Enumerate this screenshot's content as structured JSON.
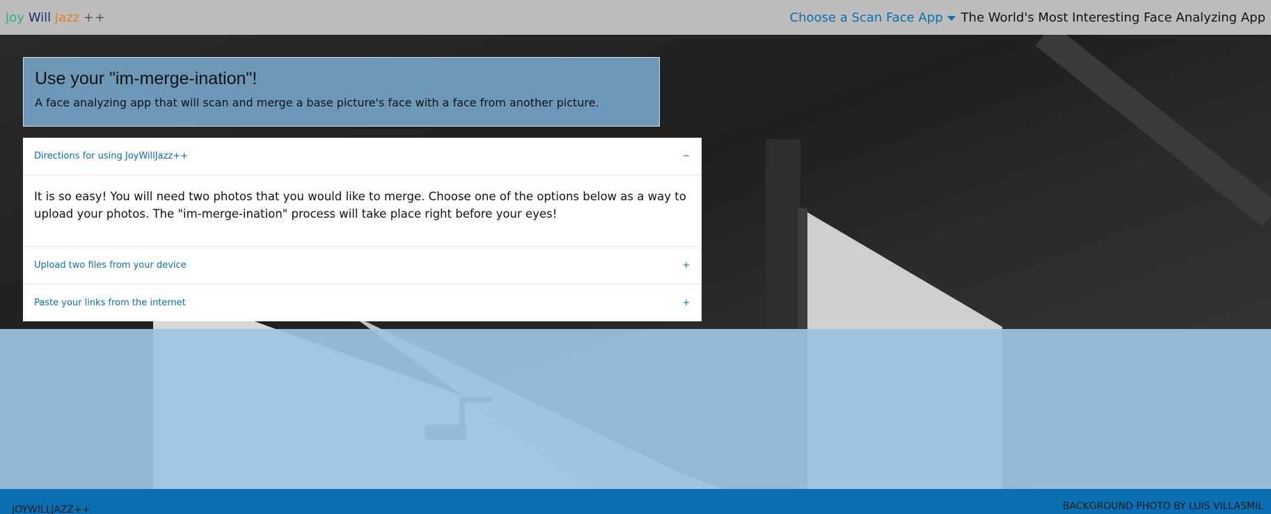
{
  "header": {
    "brand": {
      "joy": "Joy",
      "will": "Will",
      "jazz": "Jazz",
      "plus": "++"
    },
    "dropdown_label": "Choose a Scan Face App",
    "tagline": "The World's Most Interesting Face Analyzing App"
  },
  "hero": {
    "title": "Use your \"im-merge-ination\"!",
    "subtitle": "A face analyzing app that will scan and merge a base picture's face with a face from another picture."
  },
  "accordion": {
    "items": [
      {
        "title": "Directions for using JoyWillJazz++",
        "mark": "−",
        "content": "It is so easy! You will need two photos that you would like to merge. Choose one of the options below as a way to upload your photos. The \"im-merge-ination\" process will take place right before your eyes!"
      },
      {
        "title": "Upload two files from your device",
        "mark": "+"
      },
      {
        "title": "Paste your links from the internet",
        "mark": "+"
      }
    ]
  },
  "footer": {
    "left": "JOYWILLJAZZ++",
    "right": "BACKGROUND PHOTO BY LUIS VILLASMIL"
  },
  "colors": {
    "topbar": "#bdbdbd",
    "accent": "#0a6fb0",
    "hero_bg": "#6d98b7",
    "band": "#9dc4e2",
    "footer": "#0a70b3"
  }
}
